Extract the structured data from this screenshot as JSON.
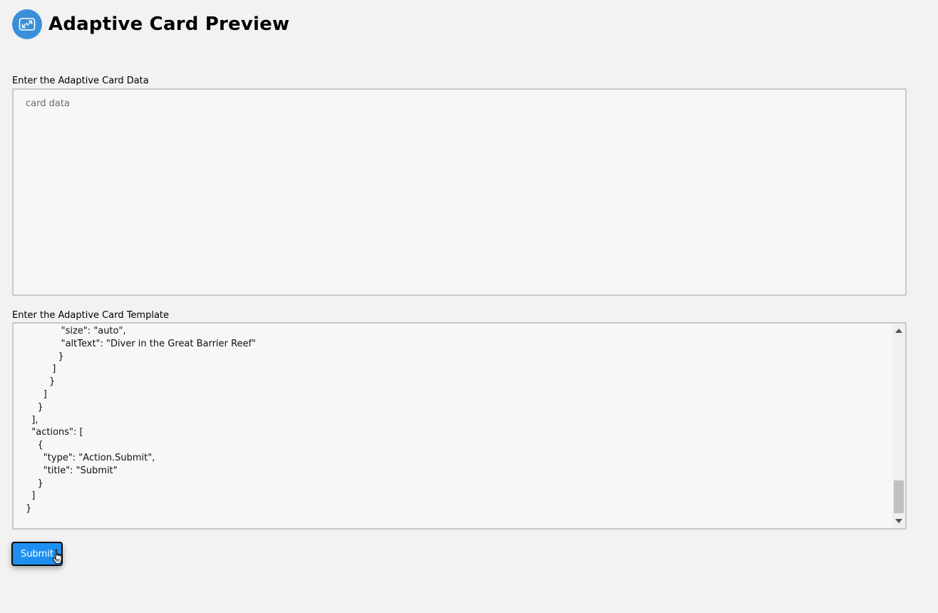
{
  "header": {
    "title": "Adaptive Card Preview",
    "logo_icon": "expand-arrows-icon"
  },
  "card_data": {
    "label": "Enter the Adaptive Card Data",
    "placeholder": "card data",
    "value": ""
  },
  "card_template": {
    "label": "Enter the Adaptive Card Template",
    "visible_lines": [
      "            \"size\": \"auto\",",
      "            \"altText\": \"Diver in the Great Barrier Reef\"",
      "           }",
      "         ]",
      "        }",
      "      ]",
      "    }",
      "  ],",
      "  \"actions\": [",
      "    {",
      "      \"type\": \"Action.Submit\",",
      "      \"title\": \"Submit\"",
      "    }",
      "  ]",
      "}"
    ]
  },
  "submit_button": {
    "label": "Submit"
  },
  "colors": {
    "background": "#f2f2f2",
    "accent": "#1e8ff2",
    "logo": "#3a8fd9"
  }
}
